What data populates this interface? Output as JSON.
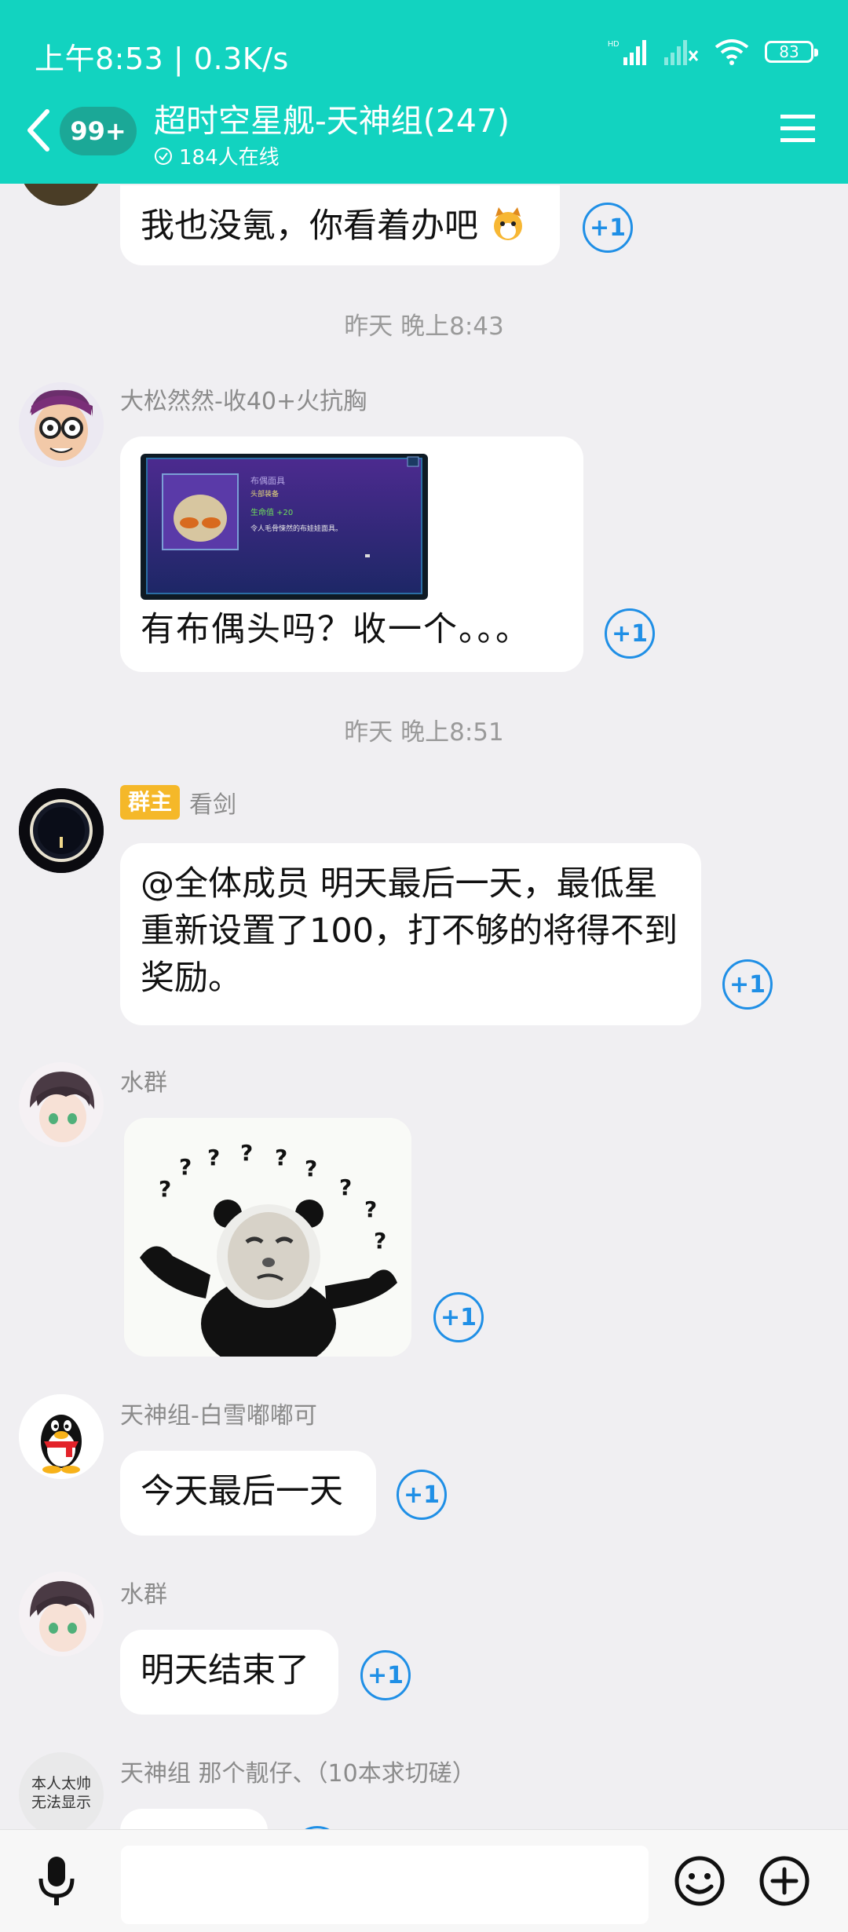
{
  "status_bar": {
    "time_text": "上午8:53 | 0.3K/s",
    "battery": "83"
  },
  "header": {
    "unread_badge": "99+",
    "group_title": "超时空星舰-天神组(247)",
    "online_text": "184人在线"
  },
  "messages": [
    {
      "type": "text",
      "text": "我也没氪，你看着办吧"
    },
    {
      "type": "timestamp",
      "text": "昨天 晚上8:43"
    },
    {
      "type": "image_text",
      "sender": "大松然然-收40+火抗胸",
      "card": {
        "title": "布偶面具",
        "subtitle": "头部装备",
        "stat": "生命值 +20",
        "desc": "令人毛骨悚然的布娃娃面具。"
      },
      "text": "有布偶头吗？收一个。。。"
    },
    {
      "type": "timestamp",
      "text": "昨天 晚上8:51"
    },
    {
      "type": "text",
      "sender": "看剑",
      "role": "群主",
      "text": "@全体成员 明天最后一天，最低星重新设置了100，打不够的将得不到奖励。"
    },
    {
      "type": "sticker",
      "sender": "水群"
    },
    {
      "type": "text",
      "sender": "天神组-白雪嘟嘟可",
      "text": "今天最后一天"
    },
    {
      "type": "text",
      "sender": "水群",
      "text": "明天结束了"
    },
    {
      "type": "partial",
      "sender": "天神组 那个靓仔、（10本求切磋）",
      "avatar_text": [
        "本人太帅",
        "无法显示"
      ]
    }
  ],
  "plus_one_label": "+1",
  "colors": {
    "header": "#12d3c0",
    "accent": "#1f8fe6",
    "owner_badge": "#f5b829"
  }
}
